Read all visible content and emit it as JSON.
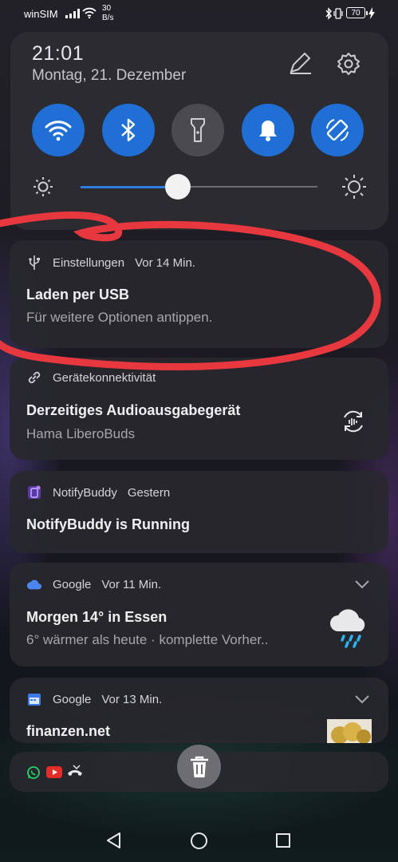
{
  "status_bar": {
    "carrier": "winSIM",
    "speed_value": "30",
    "speed_unit": "B/s",
    "battery": "70"
  },
  "quick_settings": {
    "time": "21:01",
    "date": "Montag, 21. Dezember",
    "tiles": [
      {
        "name": "wifi",
        "icon": "wifi-icon",
        "state": "on"
      },
      {
        "name": "bluetooth",
        "icon": "bluetooth-icon",
        "state": "on"
      },
      {
        "name": "flashlight",
        "icon": "flashlight-icon",
        "state": "off"
      },
      {
        "name": "sound",
        "icon": "bell-icon",
        "state": "on"
      },
      {
        "name": "auto-rotate",
        "icon": "rotate-icon",
        "state": "on"
      }
    ],
    "brightness_level": 0.41,
    "accent_color": "#1f6fd6"
  },
  "notifications": [
    {
      "app": "Einstellungen",
      "time": "Vor 14 Min.",
      "title": "Laden per USB",
      "text": "Für weitere Optionen antippen.",
      "icon": "usb-icon"
    },
    {
      "app": "Gerätekonnektivität",
      "time": "",
      "title": "Derzeitiges Audioausgabegerät",
      "text": "Hama LiberoBuds",
      "icon": "link-icon"
    },
    {
      "app": "NotifyBuddy",
      "time": "Gestern",
      "title": "NotifyBuddy is Running",
      "text": "",
      "icon": "notifybuddy-icon"
    },
    {
      "app": "Google",
      "time": "Vor 11 Min.",
      "title": "Morgen 14° in Essen",
      "text": "6° wärmer als heute · komplette Vorher..",
      "icon": "cloud-icon"
    },
    {
      "app": "Google",
      "time": "Vor 13 Min.",
      "title": "finanzen.net",
      "text": "",
      "icon": "calendar-icon"
    }
  ],
  "annotation_color": "#e8383f"
}
